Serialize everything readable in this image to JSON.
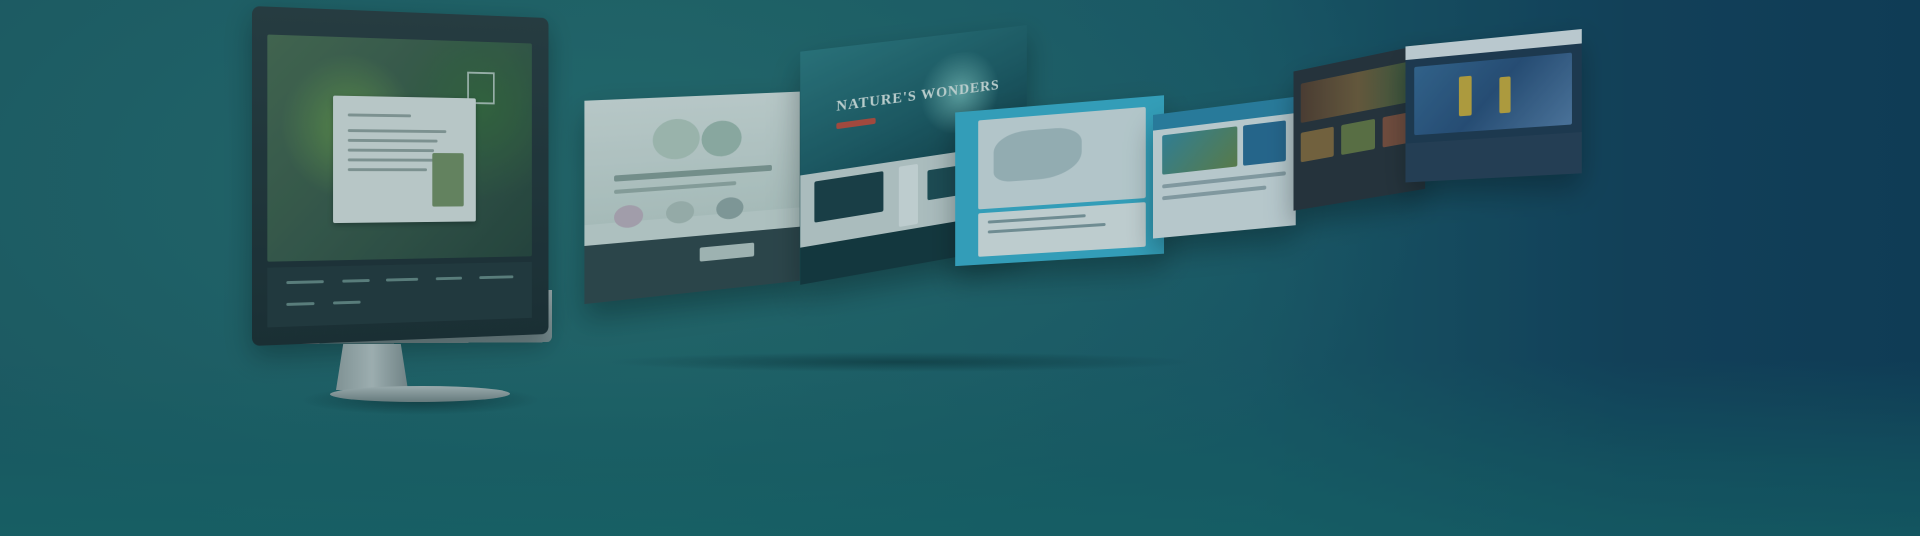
{
  "hero": {
    "background_colors": [
      "#1f6368",
      "#0f3a58"
    ],
    "pages": [
      {
        "name": "restaurant-page",
        "accent": "#5e8a52"
      },
      {
        "name": "pet-shop-page",
        "accent": "#b2c9b8"
      },
      {
        "name": "natures-wonders-page",
        "accent": "#1e5c66",
        "headline": "NATURE'S WONDERS"
      },
      {
        "name": "map-page",
        "accent": "#3db7d6"
      },
      {
        "name": "coral-page",
        "accent": "#3a8fa6"
      },
      {
        "name": "food-page",
        "accent": "#2b2f38"
      },
      {
        "name": "event-page",
        "accent": "#2c4f7e"
      }
    ]
  }
}
